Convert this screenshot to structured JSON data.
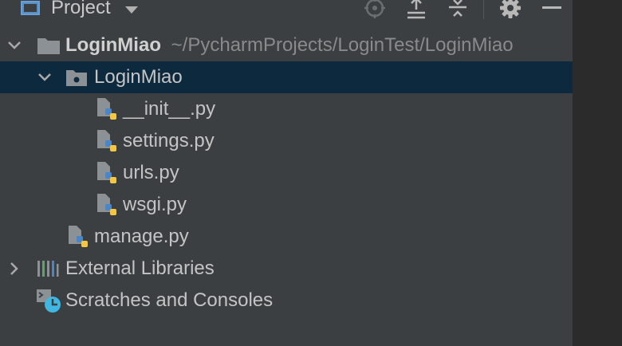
{
  "header": {
    "title": "Project",
    "tools": [
      "locate-icon",
      "expand-all-icon",
      "collapse-all-icon",
      "gear-icon",
      "minimize-icon"
    ]
  },
  "tree": {
    "root": {
      "label": "LoginMiao",
      "path": "~/PycharmProjects/LoginTest/LoginMiao"
    },
    "package": {
      "label": "LoginMiao"
    },
    "files": [
      "__init__.py",
      "settings.py",
      "urls.py",
      "wsgi.py"
    ],
    "manage": "manage.py",
    "external": "External Libraries",
    "scratches": "Scratches and Consoles"
  },
  "colors": {
    "panel_bg": "#3c3f41",
    "selection_bg": "#0d293e",
    "folder": "#8c9196",
    "python_blue": "#4a86c7",
    "python_yellow": "#f2c744"
  }
}
